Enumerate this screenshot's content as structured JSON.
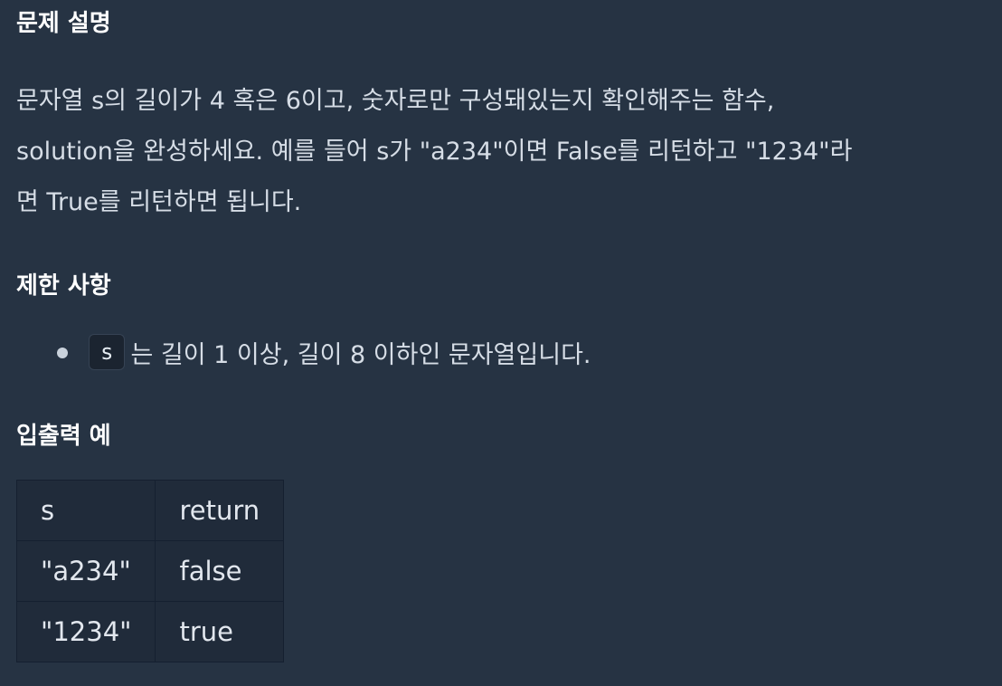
{
  "sections": {
    "description_title": "문제 설명",
    "constraints_title": "제한 사항",
    "io_title": "입출력 예"
  },
  "description": {
    "lines": [
      "문자열 s의 길이가 4 혹은 6이고, 숫자로만 구성돼있는지 확인해주는 함수,",
      "solution을 완성하세요. 예를 들어 s가 \"a234\"이면 False를 리턴하고 \"1234\"라",
      "면 True를 리턴하면 됩니다."
    ]
  },
  "constraints": {
    "items": [
      {
        "code": "s",
        "text": "는 길이 1 이상, 길이 8 이하인 문자열입니다."
      }
    ]
  },
  "io_table": {
    "headers": [
      "s",
      "return"
    ],
    "rows": [
      [
        "\"a234\"",
        "false"
      ],
      [
        "\"1234\"",
        "true"
      ]
    ]
  }
}
